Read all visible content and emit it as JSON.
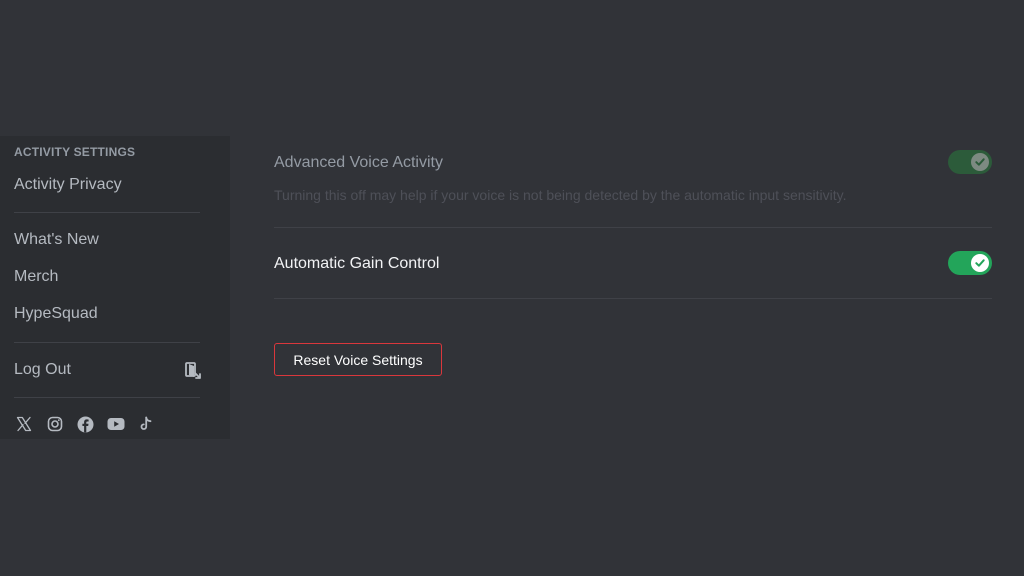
{
  "sidebar": {
    "section_header": "ACTIVITY SETTINGS",
    "items": [
      {
        "label": "Activity Privacy"
      },
      {
        "label": "What's New"
      },
      {
        "label": "Merch"
      },
      {
        "label": "HypeSquad"
      }
    ],
    "logout_label": "Log Out",
    "logout_icon": "logout-icon",
    "socials": [
      "x-icon",
      "instagram-icon",
      "facebook-icon",
      "youtube-icon",
      "tiktok-icon"
    ]
  },
  "settings": {
    "advanced_voice_activity": {
      "title": "Advanced Voice Activity",
      "description": "Turning this off may help if your voice is not being detected by the automatic input sensitivity.",
      "enabled": true,
      "disabled_state": true
    },
    "automatic_gain_control": {
      "title": "Automatic Gain Control",
      "enabled": true
    },
    "reset_button_label": "Reset Voice Settings"
  },
  "colors": {
    "background": "#313338",
    "sidebar": "#2b2d31",
    "toggle_on": "#23a55a",
    "danger": "#da373c"
  }
}
